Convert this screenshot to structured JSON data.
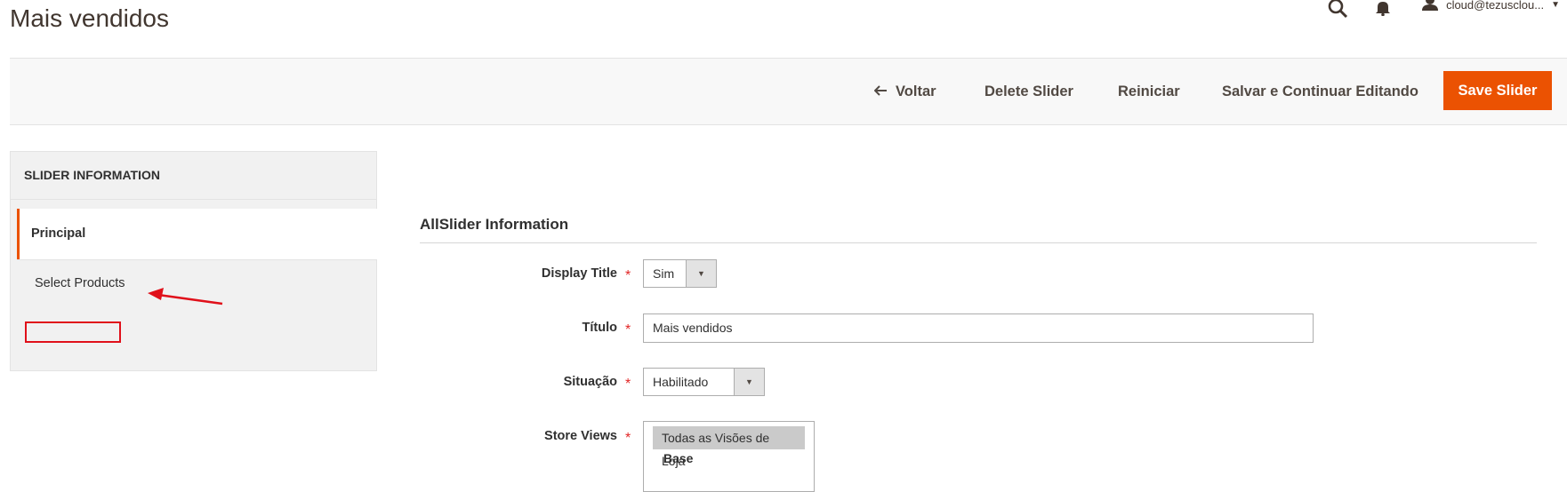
{
  "header": {
    "title": "Mais vendidos",
    "user": "cloud@tezusclou..."
  },
  "actions": {
    "back": "Voltar",
    "delete": "Delete Slider",
    "reset": "Reiniciar",
    "save_continue": "Salvar e Continuar Editando",
    "save": "Save Slider"
  },
  "sidebar": {
    "title": "SLIDER INFORMATION",
    "items": [
      {
        "label": "Principal",
        "active": true
      },
      {
        "label": "Select Products",
        "active": false
      }
    ]
  },
  "form": {
    "section_title": "AllSlider Information",
    "display_title": {
      "label": "Display Title",
      "value": "Sim"
    },
    "titulo": {
      "label": "Título",
      "value": "Mais vendidos"
    },
    "situacao": {
      "label": "Situação",
      "value": "Habilitado"
    },
    "store_views": {
      "label": "Store Views",
      "options": [
        "Todas as Visões de Loja"
      ],
      "group": "Base"
    },
    "required_mark": "*"
  },
  "icons": [
    "search-icon",
    "bell-icon",
    "user-icon",
    "chevron-down-icon",
    "arrow-left-icon"
  ],
  "colors": {
    "accent": "#eb5202",
    "annotation": "#e0101a",
    "required": "#e22626"
  }
}
